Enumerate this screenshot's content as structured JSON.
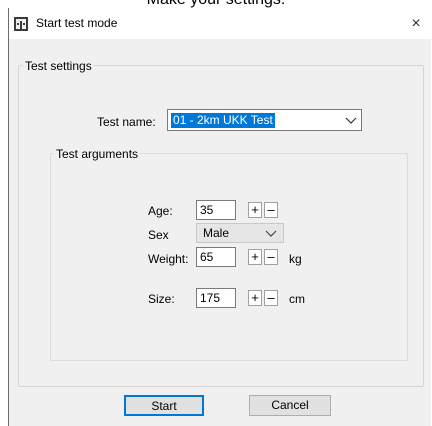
{
  "caption": "Make your settings.",
  "window": {
    "title": "Start test mode",
    "close_glyph": "×"
  },
  "test_settings": {
    "group_label": "Test settings",
    "test_name_label": "Test name:",
    "test_name_value": "01 - 2km UKK Test"
  },
  "test_arguments": {
    "group_label": "Test arguments",
    "age": {
      "label": "Age:",
      "value": "35"
    },
    "sex": {
      "label": "Sex",
      "value": "Male"
    },
    "weight": {
      "label": "Weight:",
      "value": "65",
      "unit": "kg"
    },
    "size": {
      "label": "Size:",
      "value": "175",
      "unit": "cm"
    },
    "plus": "+",
    "minus": "–"
  },
  "buttons": {
    "start": "Start",
    "cancel": "Cancel"
  },
  "colors": {
    "selection": "#0078d7",
    "window_bg": "#f0f0f0"
  }
}
